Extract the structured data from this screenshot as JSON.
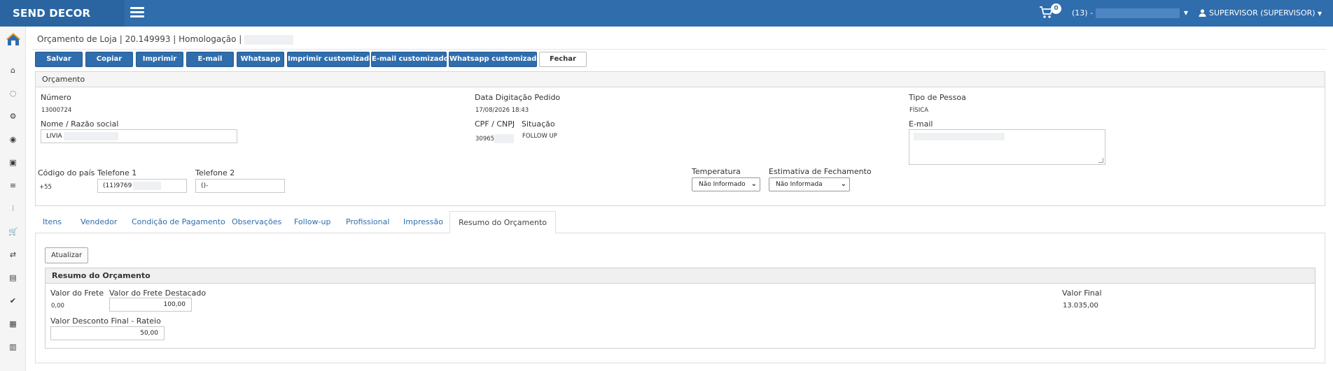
{
  "topbar": {
    "brand": "SEND DECOR",
    "cart_count": "0",
    "store_label": "(13) -",
    "user_label": "SUPERVISOR (SUPERVISOR)"
  },
  "sidebar": {
    "icons": [
      "home-icon",
      "dashboard-icon",
      "spinner-icon",
      "cogs-icon",
      "target-icon",
      "cube-icon",
      "database-icon",
      "sliders-icon",
      "cart-icon",
      "exchange-icon",
      "briefcase-icon",
      "check-icon",
      "barcode-icon",
      "bar-chart-icon"
    ]
  },
  "page": {
    "title": "Orçamento de Loja | 20.149993 | Homologação |"
  },
  "toolbar": {
    "buttons": [
      "Salvar",
      "Copiar",
      "Imprimir",
      "E-mail",
      "Whatsapp",
      "Imprimir customizado",
      "E-mail customizado",
      "Whatsapp customizado",
      "Fechar"
    ]
  },
  "orcamento": {
    "header": "Orçamento",
    "numero_label": "Número",
    "numero_value": "13000724",
    "data_label": "Data Digitação Pedido",
    "data_value": "17/08/2026 18:43",
    "tipo_label": "Tipo de Pessoa",
    "tipo_value": "FÍSICA",
    "nome_label": "Nome / Razão social",
    "nome_value": "LIVIA",
    "cpf_label": "CPF / CNPJ",
    "cpf_value": "30965",
    "situacao_label": "Situação",
    "situacao_value": "FOLLOW UP",
    "email_label": "E-mail",
    "codigo_pais_label": "Código do país",
    "codigo_pais_value": "+55",
    "telefone1_label": "Telefone 1",
    "telefone1_value": "(11)9769",
    "telefone2_label": "Telefone 2",
    "telefone2_value": "()-",
    "temperatura_label": "Temperatura",
    "temperatura_value": "Não Informado",
    "estimativa_label": "Estimativa de Fechamento",
    "estimativa_value": "Não Informada"
  },
  "tabs": [
    "Itens",
    "Vendedor",
    "Condição de Pagamento",
    "Observações",
    "Follow-up",
    "Profissional",
    "Impressão",
    "Resumo do Orçamento"
  ],
  "resumo": {
    "atualizar": "Atualizar",
    "header": "Resumo do Orçamento",
    "frete_label": "Valor do Frete",
    "frete_value": "0,00",
    "frete_destacado_label": "Valor do Frete Destacado",
    "frete_destacado_value": "100,00",
    "valor_final_label": "Valor Final",
    "valor_final_value": "13.035,00",
    "desconto_label": "Valor Desconto Final - Rateio",
    "desconto_value": "50,00"
  }
}
